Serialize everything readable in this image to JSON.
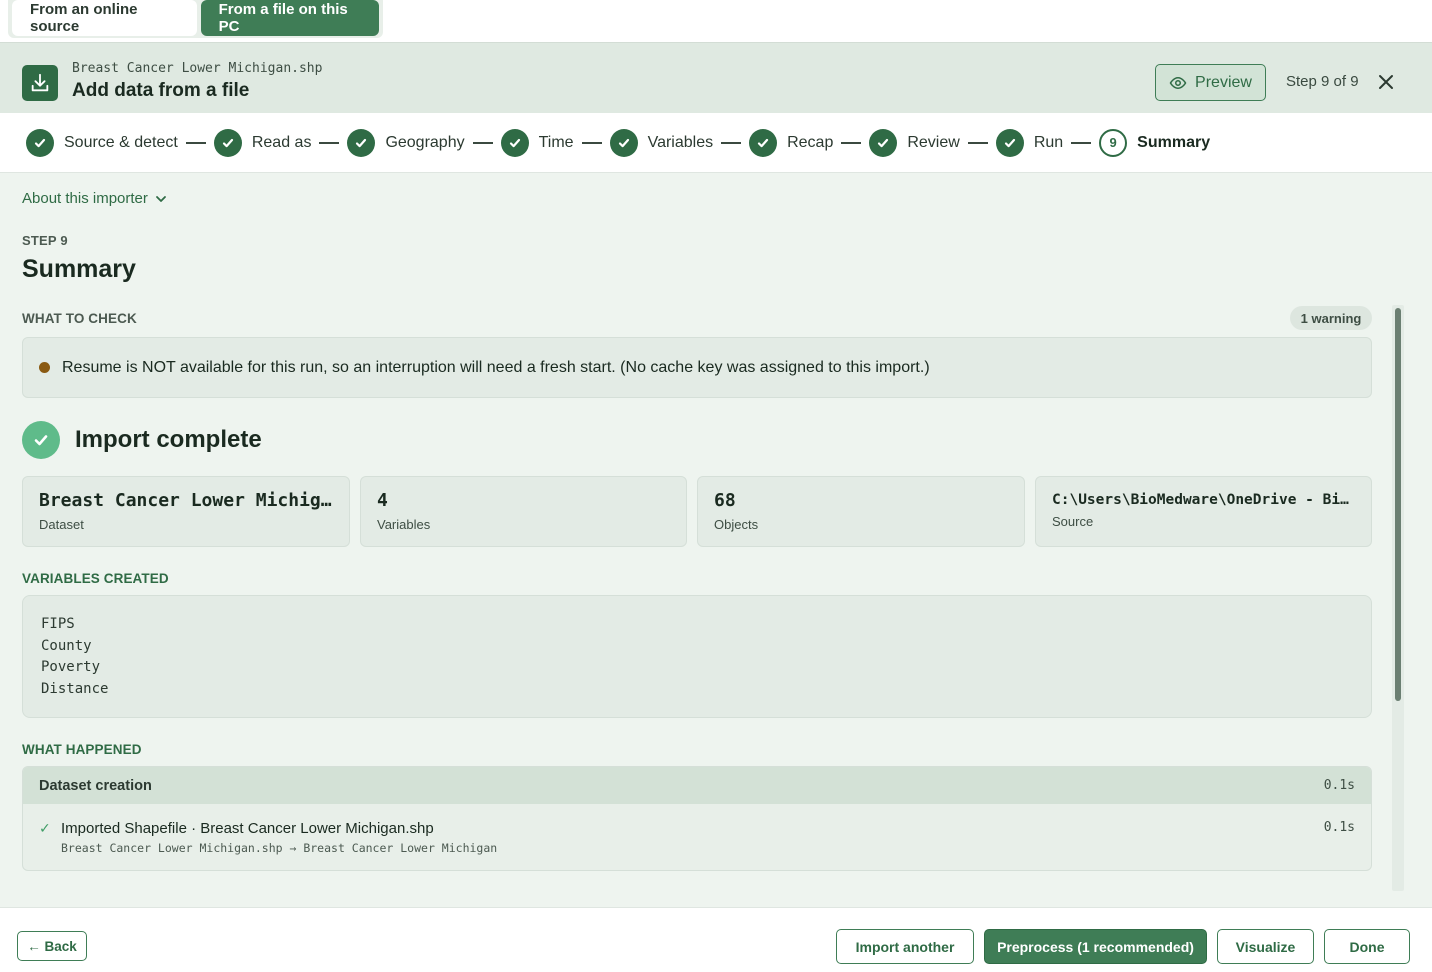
{
  "source_tabs": {
    "online": "From an online source",
    "pc": "From a file on this PC"
  },
  "header": {
    "file_name": "Breast Cancer Lower Michigan.shp",
    "title": "Add data from a file",
    "preview_label": "Preview",
    "step_count": "Step 9 of 9"
  },
  "stepper": {
    "steps": [
      "Source & detect",
      "Read as",
      "Geography",
      "Time",
      "Variables",
      "Recap",
      "Review",
      "Run",
      "Summary"
    ],
    "current_number": "9"
  },
  "main": {
    "about_label": "About this importer",
    "step_kicker": "STEP 9",
    "title": "Summary",
    "what_to_check": {
      "label": "WHAT TO CHECK",
      "badge": "1 warning",
      "warning": "Resume is NOT available for this run, so an interruption will need a fresh start. (No cache key was assigned to this import.)"
    },
    "complete_title": "Import complete",
    "stats": [
      {
        "value": "Breast Cancer Lower Michigan",
        "label": "Dataset"
      },
      {
        "value": "4",
        "label": "Variables"
      },
      {
        "value": "68",
        "label": "Objects"
      },
      {
        "value": "C:\\Users\\BioMedware\\OneDrive - BioMedware",
        "label": "Source"
      }
    ],
    "variables_created": {
      "label": "VARIABLES CREATED",
      "items": [
        "FIPS",
        "County",
        "Poverty",
        "Distance"
      ]
    },
    "what_happened": {
      "label": "WHAT HAPPENED",
      "group_title": "Dataset creation",
      "group_time": "0.1s",
      "row_title": "Imported Shapefile · Breast Cancer Lower Michigan.shp",
      "row_sub": "Breast Cancer Lower Michigan.shp → Breast Cancer Lower Michigan",
      "row_time": "0.1s"
    }
  },
  "footer": {
    "back": "← Back",
    "import_another": "Import another",
    "preprocess": "Preprocess (1 recommended)",
    "visualize": "Visualize",
    "done": "Done"
  },
  "colors": {
    "accent": "#3f7d56",
    "accent_dark": "#2f6b45",
    "warning_dot": "#8a5a12",
    "success": "#5fbb8a"
  }
}
